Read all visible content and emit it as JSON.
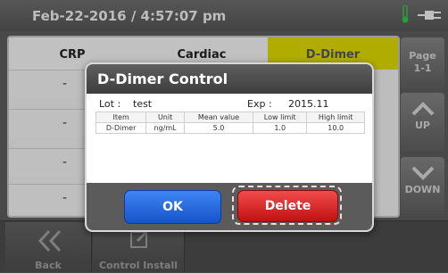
{
  "status_bar": {
    "datetime": "Feb-22-2016 / 4:57:07 pm",
    "icons": [
      "thermometer-icon",
      "plug-icon"
    ],
    "accent": "#2ec24a"
  },
  "table": {
    "headers": [
      "CRP",
      "Cardiac",
      "D-Dimer"
    ],
    "active_header_color": "#d8d400",
    "rows": [
      "-",
      "-",
      "-",
      "-"
    ]
  },
  "side": {
    "page_label": "Page",
    "page_num": "1-1",
    "up_label": "UP",
    "down_label": "DOWN"
  },
  "bottom": {
    "back_label": "Back",
    "control_install_label": "Control Install"
  },
  "dialog": {
    "title": "D-Dimer Control",
    "lot_label": "Lot :",
    "lot_value": "test",
    "exp_label": "Exp :",
    "exp_value": "2015.11",
    "columns": [
      "Item",
      "Unit",
      "Mean value",
      "Low limit",
      "High limit"
    ],
    "rows": [
      [
        "D-Dimer",
        "ng/mL",
        "5.0",
        "1.0",
        "10.0"
      ]
    ],
    "ok_label": "OK",
    "delete_label": "Delete",
    "ok_color": "#2a6ee6",
    "delete_color": "#e02424"
  }
}
